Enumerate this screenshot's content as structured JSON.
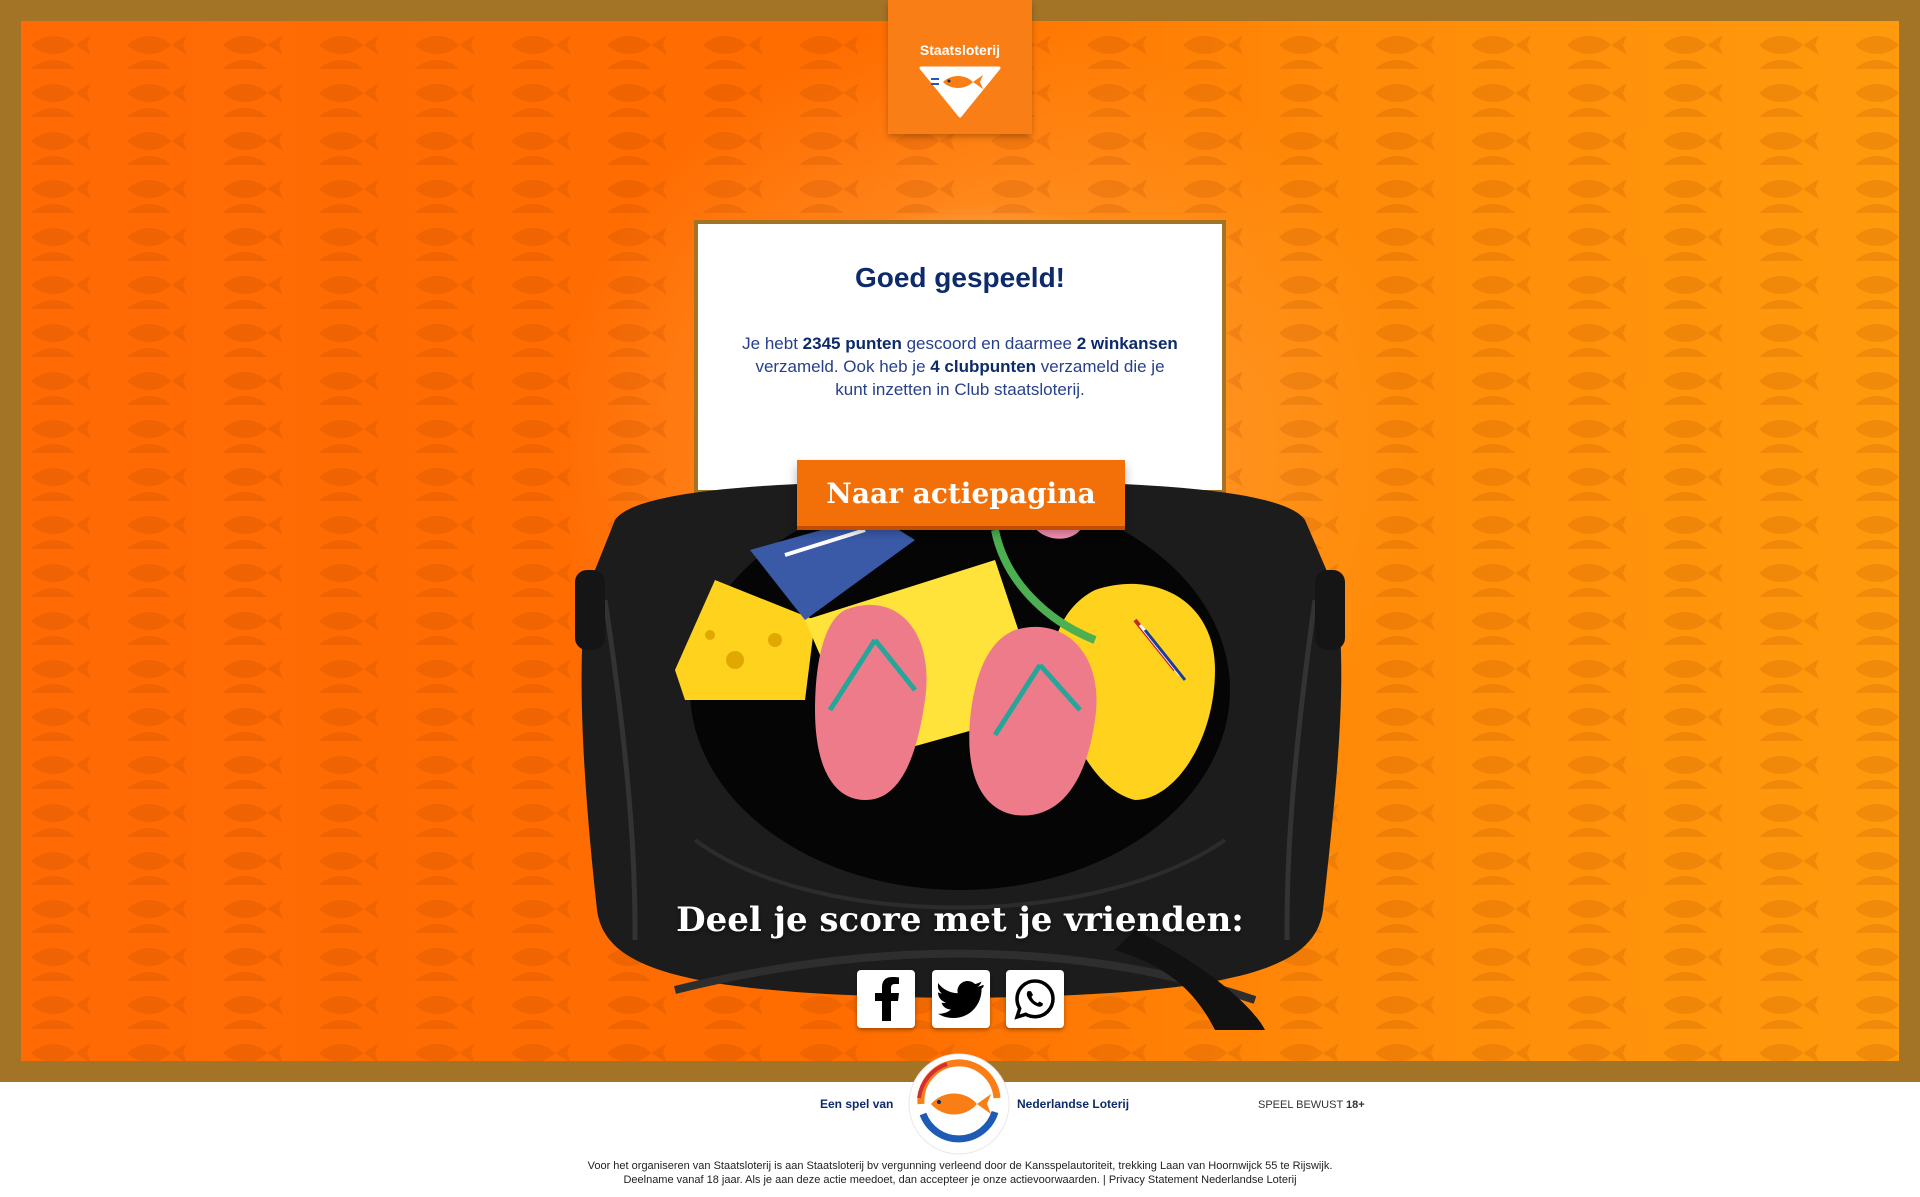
{
  "header": {
    "brand": "Staatsloterij"
  },
  "result_card": {
    "title": "Goed gespeeld!",
    "text_1": "Je hebt ",
    "points": "2345 punten",
    "text_2": " gescoord en daarmee ",
    "chances": "2 winkansen",
    "text_3": " verzameld. Ook heb je ",
    "clubpoints": "4 clubpunten",
    "text_4": " verzameld die je kunt inzetten in Club staatsloterij."
  },
  "cta": {
    "label": "Naar actiepagina"
  },
  "share": {
    "title": "Deel je score met je vrienden:",
    "icons": [
      "facebook-icon",
      "twitter-icon",
      "whatsapp-icon"
    ]
  },
  "footer": {
    "left_label": "Een spel van",
    "right_label": "Nederlandse Loterij",
    "speel_text": "SPEEL BEWUST ",
    "age": "18+",
    "legal_line_1": "Voor het organiseren van Staatsloterij is aan Staatsloterij bv vergunning verleend door de Kansspelautoriteit, trekking Laan van Hoornwijck 55 te Rijswijk.",
    "legal_line_2a": "Deelname vanaf 18 jaar. Als je aan deze actie meedoet, dan accepteer je onze ",
    "terms_link": "actievoorwaarden",
    "legal_sep": ". | ",
    "privacy_link": "Privacy Statement Nederlandse Loterij"
  },
  "colors": {
    "frame": "#a37426",
    "orange": "#ff6d00",
    "button": "#f36f08",
    "navy": "#0d2b6b"
  }
}
